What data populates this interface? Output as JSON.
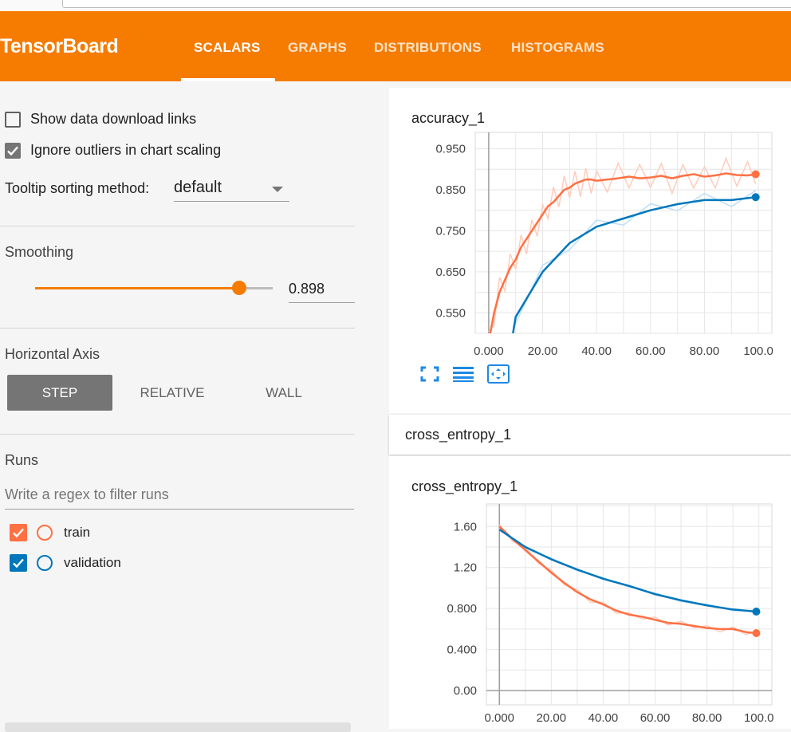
{
  "app": {
    "title": "TensorBoard"
  },
  "tabs": [
    {
      "label": "SCALARS",
      "active": true
    },
    {
      "label": "GRAPHS",
      "active": false
    },
    {
      "label": "DISTRIBUTIONS",
      "active": false
    },
    {
      "label": "HISTOGRAMS",
      "active": false
    }
  ],
  "sidebar": {
    "show_download_label": "Show data download links",
    "show_download_checked": false,
    "ignore_outliers_label": "Ignore outliers in chart scaling",
    "ignore_outliers_checked": true,
    "tooltip_sort_label": "Tooltip sorting method:",
    "tooltip_sort_value": "default",
    "smoothing_title": "Smoothing",
    "smoothing_value": "0.898",
    "smoothing_fraction": 0.898,
    "horizontal_axis_title": "Horizontal Axis",
    "axis_buttons": [
      "STEP",
      "RELATIVE",
      "WALL"
    ],
    "axis_selected": "STEP",
    "runs_title": "Runs",
    "runs_filter_placeholder": "Write a regex to filter runs",
    "runs": [
      {
        "label": "train",
        "checked": true,
        "color": "#ff7043"
      },
      {
        "label": "validation",
        "checked": true,
        "color": "#0077bb"
      }
    ]
  },
  "colors": {
    "header": "#f57c00",
    "train": "#ff7043",
    "validation": "#0077bb",
    "train_raw": "#ffccbc",
    "validation_raw": "#bbdefb"
  },
  "group_header": {
    "label": "cross_entropy_1"
  },
  "icons": [
    "fullscreen-icon",
    "log-scale-icon",
    "fit-domain-icon"
  ],
  "chart_data": [
    {
      "type": "line",
      "title": "accuracy_1",
      "xlabel": "",
      "ylabel": "",
      "xlim": [
        -5,
        105
      ],
      "ylim": [
        0.5,
        0.99
      ],
      "xticks": [
        "0.000",
        "20.00",
        "40.00",
        "60.00",
        "80.00",
        "100.0"
      ],
      "yticks": [
        "0.950",
        "0.850",
        "0.750",
        "0.650",
        "0.550"
      ],
      "series": [
        {
          "name": "train",
          "x": [
            0,
            2,
            4,
            6,
            8,
            10,
            12,
            14,
            16,
            18,
            20,
            22,
            24,
            26,
            28,
            30,
            32,
            34,
            36,
            38,
            40,
            44,
            48,
            52,
            56,
            60,
            64,
            68,
            72,
            76,
            80,
            84,
            88,
            92,
            96,
            99
          ],
          "y": [
            0.48,
            0.55,
            0.6,
            0.63,
            0.66,
            0.68,
            0.71,
            0.73,
            0.75,
            0.77,
            0.79,
            0.81,
            0.82,
            0.835,
            0.85,
            0.855,
            0.865,
            0.87,
            0.875,
            0.875,
            0.872,
            0.875,
            0.878,
            0.882,
            0.878,
            0.88,
            0.884,
            0.878,
            0.884,
            0.888,
            0.882,
            0.885,
            0.89,
            0.886,
            0.885,
            0.888
          ]
        },
        {
          "name": "validation",
          "x": [
            9,
            10,
            20,
            30,
            40,
            50,
            60,
            70,
            80,
            90,
            99
          ],
          "y": [
            0.5,
            0.54,
            0.65,
            0.72,
            0.76,
            0.78,
            0.8,
            0.815,
            0.825,
            0.825,
            0.832
          ]
        }
      ]
    },
    {
      "type": "line",
      "title": "cross_entropy_1",
      "xlabel": "",
      "ylabel": "",
      "xlim": [
        -5,
        105
      ],
      "ylim": [
        -0.14,
        1.82
      ],
      "xticks": [
        "0.000",
        "20.00",
        "40.00",
        "60.00",
        "80.00",
        "100.0"
      ],
      "yticks": [
        "1.60",
        "1.20",
        "0.800",
        "0.400",
        "0.00"
      ],
      "series": [
        {
          "name": "train",
          "x": [
            0,
            5,
            10,
            15,
            20,
            25,
            30,
            35,
            40,
            45,
            50,
            55,
            60,
            65,
            70,
            75,
            80,
            85,
            90,
            95,
            99
          ],
          "y": [
            1.6,
            1.48,
            1.37,
            1.26,
            1.15,
            1.05,
            0.96,
            0.89,
            0.84,
            0.78,
            0.74,
            0.72,
            0.69,
            0.66,
            0.65,
            0.63,
            0.61,
            0.6,
            0.6,
            0.57,
            0.56
          ]
        },
        {
          "name": "validation",
          "x": [
            0,
            10,
            20,
            30,
            40,
            50,
            60,
            70,
            80,
            90,
            99
          ],
          "y": [
            1.57,
            1.4,
            1.28,
            1.18,
            1.09,
            1.02,
            0.94,
            0.88,
            0.83,
            0.79,
            0.77
          ]
        }
      ]
    }
  ]
}
